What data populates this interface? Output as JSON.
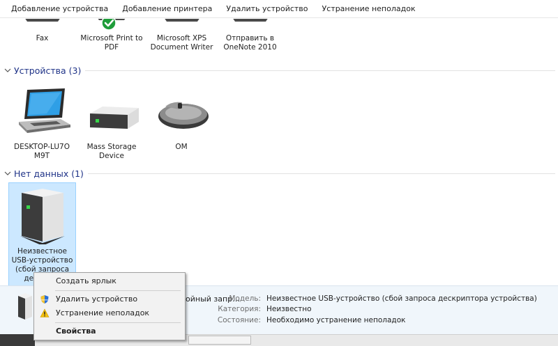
{
  "toolbar": {
    "items": [
      "Добавление устройства",
      "Добавление принтера",
      "Удалить устройство",
      "Устранение неполадок"
    ]
  },
  "printers": [
    {
      "label": "Fax",
      "icon": "fax-icon"
    },
    {
      "label": "Microsoft Print to PDF",
      "icon": "printer-icon",
      "status": "default-printer-check-icon"
    },
    {
      "label": "Microsoft XPS Document Writer",
      "icon": "printer-icon"
    },
    {
      "label": "Отправить в OneNote 2010",
      "icon": "printer-icon"
    }
  ],
  "groups": {
    "devices": {
      "title": "Устройства (3)"
    },
    "no_data": {
      "title": "Нет данных (1)"
    }
  },
  "devices": [
    {
      "label": "DESKTOP-LU7O M9T",
      "icon": "laptop-icon"
    },
    {
      "label": "Mass Storage Device",
      "icon": "mass-storage-icon"
    },
    {
      "label": "OM",
      "icon": "mouse-icon"
    }
  ],
  "unknown_device": {
    "label": "Неизвестное USB-устройство (сбой запроса дескрипт",
    "icon": "usb-device-icon"
  },
  "details": {
    "name": "ойный запр…",
    "rows": [
      {
        "key": "Модель:",
        "value": "Неизвестное USB-устройство (сбой запроса дескриптора устройства)"
      },
      {
        "key": "Категория:",
        "value": "Неизвестно"
      },
      {
        "key": "Состояние:",
        "value": "Необходимо устранение неполадок"
      }
    ]
  },
  "context_menu": {
    "items": [
      {
        "label": "Создать ярлык"
      },
      {
        "label": "Удалить устройство",
        "icon": "uac-shield-icon"
      },
      {
        "label": "Устранение неполадок",
        "icon": "warning-icon"
      },
      {
        "label": "Свойства",
        "bold": true
      }
    ]
  },
  "colors": {
    "group_title": "#1e3287",
    "selection_bg": "#cce8ff",
    "selection_border": "#99d1ff",
    "details_bg": "#f0f6fb"
  }
}
